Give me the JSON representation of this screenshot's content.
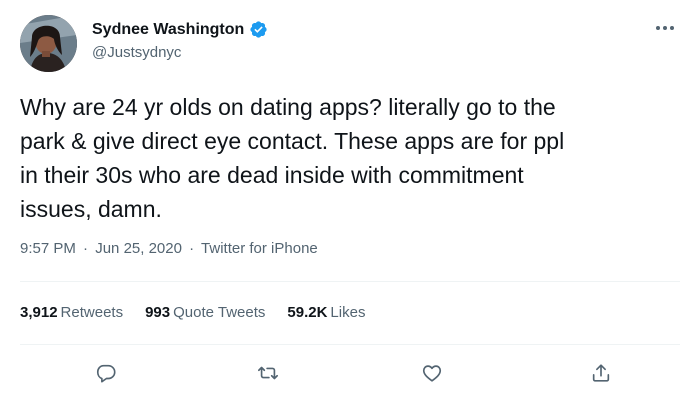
{
  "author": {
    "display_name": "Sydnee Washington",
    "handle": "@Justsydnyc",
    "verified": true
  },
  "tweet": {
    "text": "Why are 24 yr olds on dating apps? literally go to the\npark & give direct eye contact. These apps are for ppl\nin their 30s who are dead inside with commitment\nissues, damn."
  },
  "meta": {
    "time": "9:57 PM",
    "separator": "·",
    "date": "Jun 25, 2020",
    "source": "Twitter for iPhone"
  },
  "stats": {
    "retweets_count": "3,912",
    "retweets_label": "Retweets",
    "quotes_count": "993",
    "quotes_label": "Quote Tweets",
    "likes_count": "59.2K",
    "likes_label": "Likes"
  },
  "actions": [
    {
      "name": "reply",
      "icon": "reply-icon"
    },
    {
      "name": "retweet",
      "icon": "retweet-icon"
    },
    {
      "name": "like",
      "icon": "heart-icon"
    },
    {
      "name": "share",
      "icon": "share-icon"
    }
  ],
  "colors": {
    "verified": "#1d9bf0",
    "text_primary": "#0f1419",
    "text_secondary": "#536471",
    "divider": "#eff3f4"
  }
}
